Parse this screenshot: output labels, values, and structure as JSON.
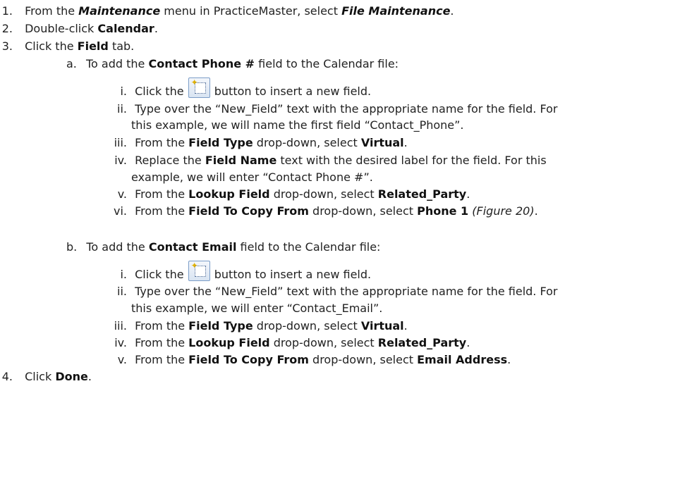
{
  "steps": {
    "s1": {
      "num": "1.",
      "t1": "From the ",
      "b1": "Maintenance",
      "t2": " menu in PracticeMaster, select ",
      "b2": "File Maintenance",
      "t3": "."
    },
    "s2": {
      "num": "2.",
      "t1": "Double-click ",
      "b1": "Calendar",
      "t2": "."
    },
    "s3": {
      "num": "3.",
      "t1": "Click the ",
      "b1": "Field",
      "t2": " tab."
    },
    "a": {
      "num": "a.",
      "t1": "To add the ",
      "b1": "Contact Phone #",
      "t2": " field to the Calendar file:",
      "i": {
        "num": "i.",
        "t1": "Click the ",
        "t2": " button to insert a new field."
      },
      "ii": {
        "num": "ii.",
        "l1": "Type over the “New_Field” text with the appropriate name for the field. For",
        "l2": "this example, we will name the first field “Contact_Phone”."
      },
      "iii": {
        "num": "iii.",
        "t1": "From the ",
        "b1": "Field Type",
        "t2": " drop-down, select ",
        "b2": "Virtual",
        "t3": "."
      },
      "iv": {
        "num": "iv.",
        "t1": "Replace the ",
        "b1": "Field Name",
        "t2": " text with the desired label for the field. For this",
        "l2": "example, we will enter “Contact Phone #”."
      },
      "v": {
        "num": "v.",
        "t1": "From the ",
        "b1": "Lookup Field",
        "t2": " drop-down, select ",
        "b2": "Related_Party",
        "t3": "."
      },
      "vi": {
        "num": "vi.",
        "t1": "From the ",
        "b1": "Field To Copy From",
        "t2": " drop-down, select ",
        "b2": "Phone 1",
        "t3": " ",
        "i1": "(Figure 20)",
        "t4": "."
      }
    },
    "b": {
      "num": "b.",
      "t1": "To add the ",
      "b1": "Contact Email",
      "t2": " field to the Calendar file:",
      "i": {
        "num": "i.",
        "t1": "Click the ",
        "t2": " button to insert a new field."
      },
      "ii": {
        "num": "ii.",
        "l1": "Type over the “New_Field” text with the appropriate name for the field. For",
        "l2": "this example, we will enter “Contact_Email”."
      },
      "iii": {
        "num": "iii.",
        "t1": "From the ",
        "b1": "Field Type",
        "t2": " drop-down, select ",
        "b2": "Virtual",
        "t3": "."
      },
      "iv": {
        "num": "iv.",
        "t1": "From the ",
        "b1": "Lookup Field",
        "t2": " drop-down, select ",
        "b2": "Related_Party",
        "t3": "."
      },
      "v": {
        "num": "v.",
        "t1": "From the ",
        "b1": "Field To Copy From",
        "t2": " drop-down, select ",
        "b2": "Email Address",
        "t3": "."
      }
    },
    "s4": {
      "num": "4.",
      "t1": "Click ",
      "b1": "Done",
      "t2": "."
    }
  },
  "icons": {
    "insert_field": "new-field-icon"
  }
}
